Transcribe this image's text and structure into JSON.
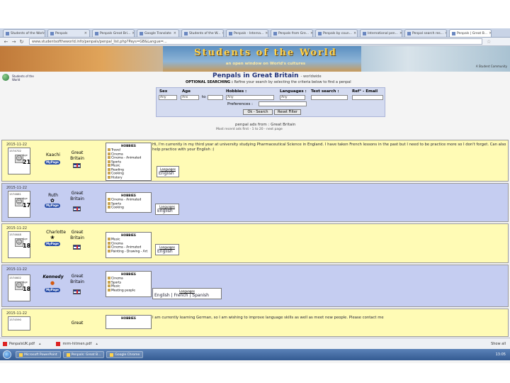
{
  "browser": {
    "tabs": [
      {
        "label": "Students of the World",
        "active": false
      },
      {
        "label": "Penpals",
        "active": false
      },
      {
        "label": "Penpals Great Bri...",
        "active": false
      },
      {
        "label": "Google Translate",
        "active": false
      },
      {
        "label": "Students of the W...",
        "active": false
      },
      {
        "label": "Penpals - Interna...",
        "active": false
      },
      {
        "label": "Penpals from Gre...",
        "active": false
      },
      {
        "label": "Penpals by coun...",
        "active": false
      },
      {
        "label": "International pen...",
        "active": false
      },
      {
        "label": "Penpal search res...",
        "active": false
      },
      {
        "label": "Penpals | Great B...",
        "active": true
      }
    ],
    "url": "www.studentsoftheworld.info/penpals/penpal_list.php?Pays=GB&Langue=..."
  },
  "banner": {
    "title": "Students of the World",
    "tagline": "an open window on World's cultures",
    "corner": "A Student Community"
  },
  "header": {
    "logo_text": "Students of the World",
    "title": "Penpals in Great Britain",
    "title_suffix": "- worldwide",
    "optional_label": "OPTIONAL SEARCHING :",
    "optional_text": "Refine your search by selecting the criteria below to find a penpal"
  },
  "search": {
    "sex_label": "Sex",
    "age_label": "Age",
    "hobbies_label": "Hobbies :",
    "languages_label": "Languages :",
    "text_search_label": "Text search :",
    "ref_email_label": "Ref° - Email",
    "sex_value": "Any",
    "age_from": "Ans",
    "age_to_label": "to",
    "hobbies_value": "Any",
    "languages_value": "Any",
    "preferences_label": "Preferences :",
    "ok_button": "Ok - Search",
    "reset_button": "Reset Filter"
  },
  "results": {
    "caption": "penpal ads from : Great Britain",
    "sub": "Most recent ads first - 1 to 20 - next page"
  },
  "penpals": [
    {
      "date": "2015-11-22",
      "id": "1574702",
      "age": "21",
      "name": "Kaachi",
      "country": "Great Britain",
      "hobbies": [
        "Travel",
        "Cinema",
        "Cinema - Animated",
        "Sports",
        "Music",
        "Reading",
        "Cooking",
        "History"
      ],
      "languages": "English",
      "message": "Hi, I'm currently in my third year at university studying Pharmaceutical Science in England. I have taken French lessons in the past but I need to be practice more so I don't forget. Can also help practice with your English :)"
    },
    {
      "date": "2015-11-22",
      "id": "1574681",
      "age": "17",
      "name": "Ruth",
      "country": "Great Britain",
      "hobbies": [
        "Cinema - Animated",
        "Sports",
        "Cooking"
      ],
      "languages": "English",
      "message": ""
    },
    {
      "date": "2015-11-22",
      "id": "1574648",
      "age": "18",
      "name": "Charlotte",
      "country": "Great Britain",
      "hobbies": [
        "Music",
        "Cinema",
        "Cinema - Animated",
        "Painting - Drawing - Art"
      ],
      "languages": "English",
      "message": ""
    },
    {
      "date": "2015-11-22",
      "id": "1574602",
      "age": "18",
      "name": "Kennedy",
      "country": "Great Britain",
      "hobbies": [
        "Cinema",
        "Sports",
        "Music",
        "Meeting people"
      ],
      "languages": "English | French | Spanish",
      "message": ""
    },
    {
      "date": "2015-11-22",
      "id": "1574590",
      "age": "",
      "name": "",
      "country": "Great",
      "hobbies": [],
      "languages": "",
      "message": "I am currently learning German, so I am wishing to improve language skills as well as meet new people. Please contact me"
    }
  ],
  "labels": {
    "hobbies_title": "HOBBIES",
    "languages_title": "Languages",
    "age_label": "Age",
    "mypage": "MyPage"
  },
  "downloads": {
    "items": [
      "PenpalsUK.pdf",
      "mrm-hitmen.pdf"
    ],
    "show_all": "Show all"
  },
  "taskbar": {
    "items": [
      "Microsoft PowerPoint",
      "Penpals: Great B...",
      "Google Chrome"
    ],
    "tray": "13:05"
  }
}
